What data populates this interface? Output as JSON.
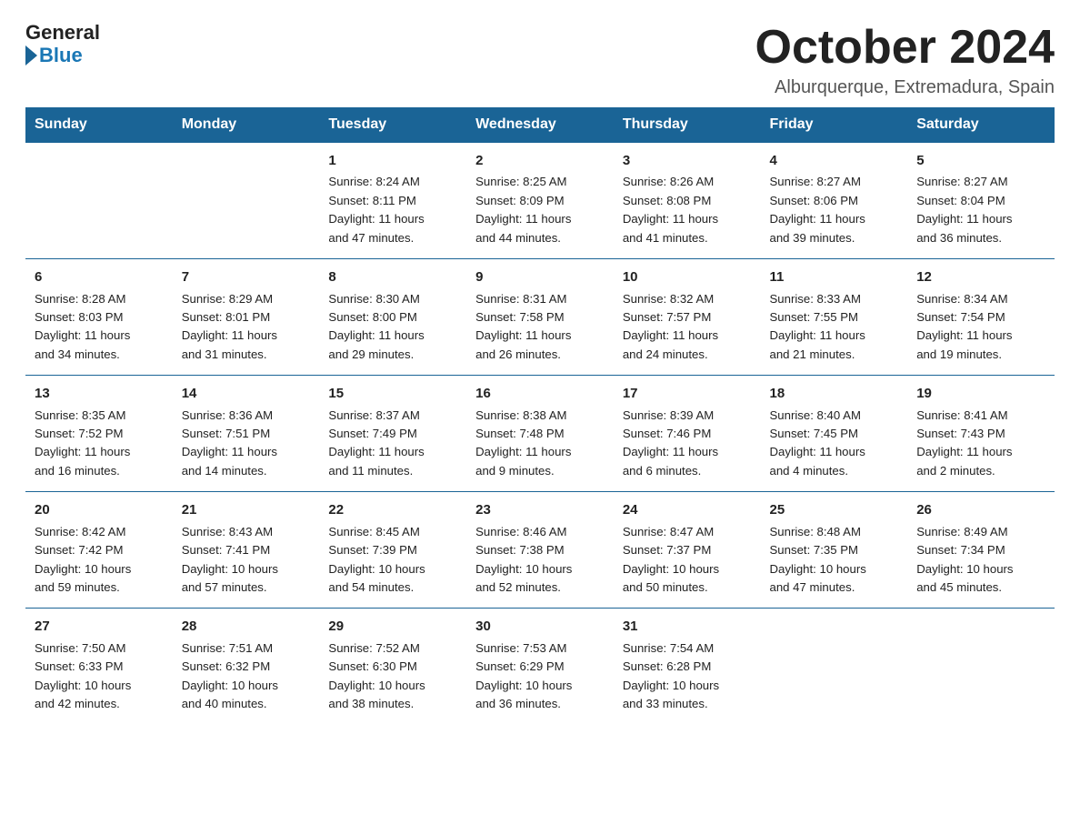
{
  "logo": {
    "general": "General",
    "blue": "Blue"
  },
  "header": {
    "month": "October 2024",
    "location": "Alburquerque, Extremadura, Spain"
  },
  "weekdays": [
    "Sunday",
    "Monday",
    "Tuesday",
    "Wednesday",
    "Thursday",
    "Friday",
    "Saturday"
  ],
  "weeks": [
    [
      {
        "day": "",
        "info": ""
      },
      {
        "day": "",
        "info": ""
      },
      {
        "day": "1",
        "info": "Sunrise: 8:24 AM\nSunset: 8:11 PM\nDaylight: 11 hours\nand 47 minutes."
      },
      {
        "day": "2",
        "info": "Sunrise: 8:25 AM\nSunset: 8:09 PM\nDaylight: 11 hours\nand 44 minutes."
      },
      {
        "day": "3",
        "info": "Sunrise: 8:26 AM\nSunset: 8:08 PM\nDaylight: 11 hours\nand 41 minutes."
      },
      {
        "day": "4",
        "info": "Sunrise: 8:27 AM\nSunset: 8:06 PM\nDaylight: 11 hours\nand 39 minutes."
      },
      {
        "day": "5",
        "info": "Sunrise: 8:27 AM\nSunset: 8:04 PM\nDaylight: 11 hours\nand 36 minutes."
      }
    ],
    [
      {
        "day": "6",
        "info": "Sunrise: 8:28 AM\nSunset: 8:03 PM\nDaylight: 11 hours\nand 34 minutes."
      },
      {
        "day": "7",
        "info": "Sunrise: 8:29 AM\nSunset: 8:01 PM\nDaylight: 11 hours\nand 31 minutes."
      },
      {
        "day": "8",
        "info": "Sunrise: 8:30 AM\nSunset: 8:00 PM\nDaylight: 11 hours\nand 29 minutes."
      },
      {
        "day": "9",
        "info": "Sunrise: 8:31 AM\nSunset: 7:58 PM\nDaylight: 11 hours\nand 26 minutes."
      },
      {
        "day": "10",
        "info": "Sunrise: 8:32 AM\nSunset: 7:57 PM\nDaylight: 11 hours\nand 24 minutes."
      },
      {
        "day": "11",
        "info": "Sunrise: 8:33 AM\nSunset: 7:55 PM\nDaylight: 11 hours\nand 21 minutes."
      },
      {
        "day": "12",
        "info": "Sunrise: 8:34 AM\nSunset: 7:54 PM\nDaylight: 11 hours\nand 19 minutes."
      }
    ],
    [
      {
        "day": "13",
        "info": "Sunrise: 8:35 AM\nSunset: 7:52 PM\nDaylight: 11 hours\nand 16 minutes."
      },
      {
        "day": "14",
        "info": "Sunrise: 8:36 AM\nSunset: 7:51 PM\nDaylight: 11 hours\nand 14 minutes."
      },
      {
        "day": "15",
        "info": "Sunrise: 8:37 AM\nSunset: 7:49 PM\nDaylight: 11 hours\nand 11 minutes."
      },
      {
        "day": "16",
        "info": "Sunrise: 8:38 AM\nSunset: 7:48 PM\nDaylight: 11 hours\nand 9 minutes."
      },
      {
        "day": "17",
        "info": "Sunrise: 8:39 AM\nSunset: 7:46 PM\nDaylight: 11 hours\nand 6 minutes."
      },
      {
        "day": "18",
        "info": "Sunrise: 8:40 AM\nSunset: 7:45 PM\nDaylight: 11 hours\nand 4 minutes."
      },
      {
        "day": "19",
        "info": "Sunrise: 8:41 AM\nSunset: 7:43 PM\nDaylight: 11 hours\nand 2 minutes."
      }
    ],
    [
      {
        "day": "20",
        "info": "Sunrise: 8:42 AM\nSunset: 7:42 PM\nDaylight: 10 hours\nand 59 minutes."
      },
      {
        "day": "21",
        "info": "Sunrise: 8:43 AM\nSunset: 7:41 PM\nDaylight: 10 hours\nand 57 minutes."
      },
      {
        "day": "22",
        "info": "Sunrise: 8:45 AM\nSunset: 7:39 PM\nDaylight: 10 hours\nand 54 minutes."
      },
      {
        "day": "23",
        "info": "Sunrise: 8:46 AM\nSunset: 7:38 PM\nDaylight: 10 hours\nand 52 minutes."
      },
      {
        "day": "24",
        "info": "Sunrise: 8:47 AM\nSunset: 7:37 PM\nDaylight: 10 hours\nand 50 minutes."
      },
      {
        "day": "25",
        "info": "Sunrise: 8:48 AM\nSunset: 7:35 PM\nDaylight: 10 hours\nand 47 minutes."
      },
      {
        "day": "26",
        "info": "Sunrise: 8:49 AM\nSunset: 7:34 PM\nDaylight: 10 hours\nand 45 minutes."
      }
    ],
    [
      {
        "day": "27",
        "info": "Sunrise: 7:50 AM\nSunset: 6:33 PM\nDaylight: 10 hours\nand 42 minutes."
      },
      {
        "day": "28",
        "info": "Sunrise: 7:51 AM\nSunset: 6:32 PM\nDaylight: 10 hours\nand 40 minutes."
      },
      {
        "day": "29",
        "info": "Sunrise: 7:52 AM\nSunset: 6:30 PM\nDaylight: 10 hours\nand 38 minutes."
      },
      {
        "day": "30",
        "info": "Sunrise: 7:53 AM\nSunset: 6:29 PM\nDaylight: 10 hours\nand 36 minutes."
      },
      {
        "day": "31",
        "info": "Sunrise: 7:54 AM\nSunset: 6:28 PM\nDaylight: 10 hours\nand 33 minutes."
      },
      {
        "day": "",
        "info": ""
      },
      {
        "day": "",
        "info": ""
      }
    ]
  ]
}
